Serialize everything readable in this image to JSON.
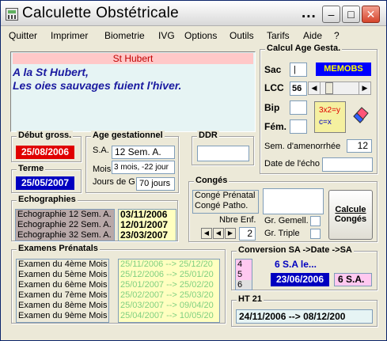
{
  "window": {
    "title": "Calculette Obstétricale",
    "title_suffix": "...",
    "min_glyph": "–",
    "max_glyph": "□",
    "close_glyph": "✕"
  },
  "menu": [
    "Quitter",
    "Imprimer",
    "Biometrie",
    "IVG",
    "Options",
    "Outils",
    "Tarifs",
    "Aide",
    "?"
  ],
  "saint": {
    "name": "St Hubert",
    "line1": "A la St Hubert,",
    "line2": "Les oies sauvages fuient l'hiver."
  },
  "debut": {
    "label": "Début gross.",
    "value": "25/08/2006"
  },
  "terme": {
    "label": "Terme",
    "value": "25/05/2007"
  },
  "age": {
    "label": "Age gestationnel",
    "sa_label": "S.A.",
    "sa_value": "12  Sem. A.",
    "mois_label": "Mois",
    "mois_value": "3 mois, -22 jour",
    "jours_label": "Jours de G",
    "jours_value": "70 jours"
  },
  "ddr": {
    "label": "DDR",
    "value": ""
  },
  "calcul": {
    "label": "Calcul Age Gesta.",
    "sac": "Sac",
    "sac_value": "|",
    "memobs": "MEMOBS",
    "lcc": "LCC",
    "lcc_value": "56",
    "bip": "Bip",
    "fem": "Fém.",
    "formula_top": "3x2=y",
    "formula_bottom": "c=x",
    "sem_amen": "Sem. d'amenorrhée",
    "sem_value": "12",
    "date_echo": "Date de l'écho",
    "date_echo_value": ""
  },
  "echo": {
    "label": "Echographies",
    "items": [
      "Echographie 12 Sem. A.",
      "Echographie 22 Sem. A.",
      "Echographie 32 Sem. A."
    ],
    "dates": [
      "03/11/2006",
      "12/01/2007",
      "23/03/2007"
    ]
  },
  "conges": {
    "label": "Congés",
    "items": [
      "Congé Prénatal",
      "Congé Patho."
    ],
    "nbre_enf": "Nbre Enf.",
    "nbre_value": "2",
    "gemell": "Gr. Gemell.",
    "triple": "Gr. Triple",
    "btn1": "Calcule",
    "btn2": "Congés",
    "result": ""
  },
  "exams": {
    "label": "Examens Prénatals",
    "items": [
      "Examen du 4ème Mois",
      "Examen du 5ème Mois",
      "Examen du 6ème Mois",
      "Examen du 7ème Mois",
      "Examen du 8ème Mois",
      "Examen du 9ème Mois"
    ],
    "dates": [
      "25/11/2006 --> 25/12/20",
      "25/12/2006 --> 25/01/20",
      "25/01/2007 --> 25/02/20",
      "25/02/2007 --> 25/03/20",
      "25/03/2007 --> 09/04/20",
      "25/04/2007 --> 10/05/20"
    ]
  },
  "conversion": {
    "label": "Conversion  SA ->Date ->SA",
    "list": [
      "4",
      "5",
      "6"
    ],
    "sa_line": "6 S.A le...",
    "date": "23/06/2006",
    "sa_value": "6  S.A."
  },
  "ht21": {
    "label": "HT 21",
    "value": "24/11/2006   -->   08/12/200"
  },
  "colors": {
    "accent_red": "#e00000",
    "accent_blue": "#0000c0",
    "navy": "#1a1aa0",
    "yellow": "#ffffc0",
    "pink": "#ffc8f0",
    "green_text": "#80d080"
  }
}
